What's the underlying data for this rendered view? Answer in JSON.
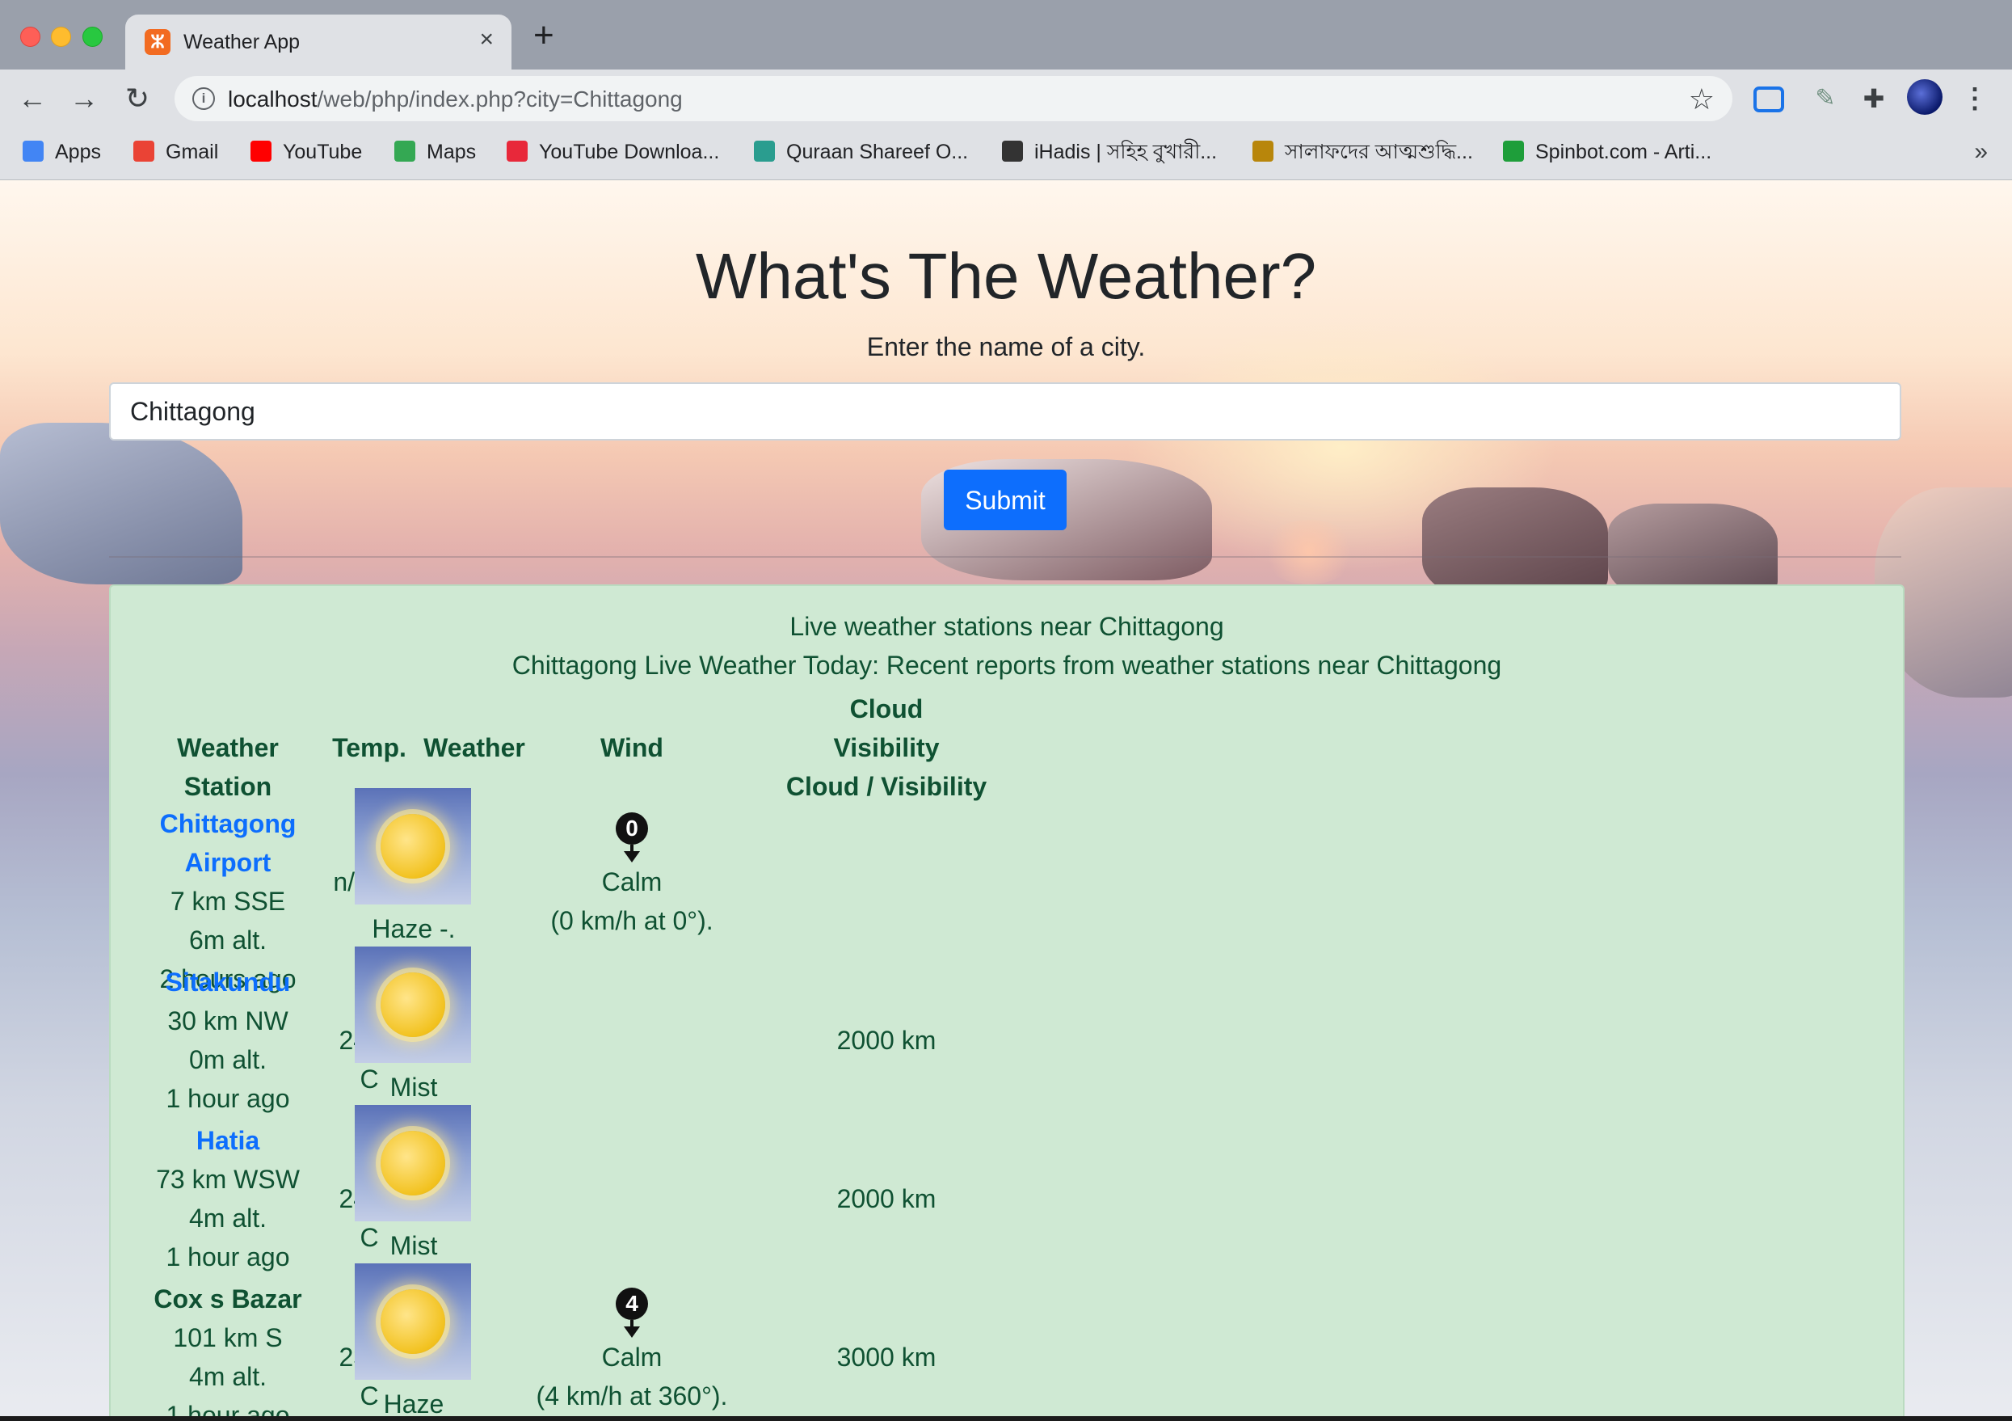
{
  "browser": {
    "tab_title": "Weather App",
    "tab_favicon": "xampp-icon",
    "new_tab": "+",
    "close": "×",
    "url_host": "localhost",
    "url_path": "/web/php/index.php?city=Chittagong",
    "bookmarks": [
      {
        "label": "Apps",
        "icon": "apps-grid-icon",
        "color": "#4285f4"
      },
      {
        "label": "Gmail",
        "icon": "gmail-icon",
        "color": "#ea4335"
      },
      {
        "label": "YouTube",
        "icon": "youtube-icon",
        "color": "#ff0000"
      },
      {
        "label": "Maps",
        "icon": "maps-pin-icon",
        "color": "#34a853"
      },
      {
        "label": "YouTube Downloa...",
        "icon": "download-icon",
        "color": "#e8283a"
      },
      {
        "label": "Quraan Shareef O...",
        "icon": "quran-icon",
        "color": "#2a9d8f"
      },
      {
        "label": "iHadis | সহিহ বুখারী...",
        "icon": "ihadis-icon",
        "color": "#333333"
      },
      {
        "label": "সালাফদের আত্মশুদ্ধি...",
        "icon": "book-icon",
        "color": "#b8860b"
      },
      {
        "label": "Spinbot.com - Arti...",
        "icon": "spinbot-icon",
        "color": "#1e9e3a"
      }
    ],
    "more": "»"
  },
  "page": {
    "title": "What's The Weather?",
    "subtitle": "Enter the name of a city.",
    "city_value": "Chittagong",
    "submit_label": "Submit",
    "accent": "#0d6efd"
  },
  "results": {
    "caption1": "Live weather stations near Chittagong",
    "caption2": "Chittagong Live Weather Today: Recent reports from weather stations near Chittagong",
    "headers": {
      "station": "Weather Station",
      "temp": "Temp.",
      "weather": "Weather",
      "wind": "Wind",
      "cloud": "Cloud",
      "visibility": "Visibility",
      "cloud_visibility": "Cloud / Visibility"
    },
    "rows": [
      {
        "name": "Chittagong Airport",
        "linked": true,
        "distance": "7 km SSE",
        "alt": "6m alt.",
        "ago": "2 hours ago",
        "temp": "n/a° C",
        "weather": "Haze -.",
        "wind_badge": "0",
        "wind_text": "Calm",
        "wind_detail": "(0 km/h at 0°).",
        "visibility": ""
      },
      {
        "name": "Sitakundu",
        "linked": true,
        "distance": "30 km NW",
        "alt": "0m alt.",
        "ago": "1 hour ago",
        "temp": "24.2° C",
        "weather": "Mist",
        "wind_badge": "",
        "wind_text": "",
        "wind_detail": "",
        "visibility": "2000 km"
      },
      {
        "name": "Hatia",
        "linked": true,
        "distance": "73 km WSW",
        "alt": "4m alt.",
        "ago": "1 hour ago",
        "temp": "24.0° C",
        "weather": "Mist",
        "wind_badge": "",
        "wind_text": "",
        "wind_detail": "",
        "visibility": "2000 km"
      },
      {
        "name": "Cox s Bazar",
        "linked": false,
        "distance": "101 km S",
        "alt": "4m alt.",
        "ago": "1 hour ago",
        "temp": "23.2° C",
        "weather": "Haze",
        "wind_badge": "4",
        "wind_text": "Calm",
        "wind_detail": "(4 km/h at 360°).",
        "visibility": "3000 km"
      }
    ]
  }
}
